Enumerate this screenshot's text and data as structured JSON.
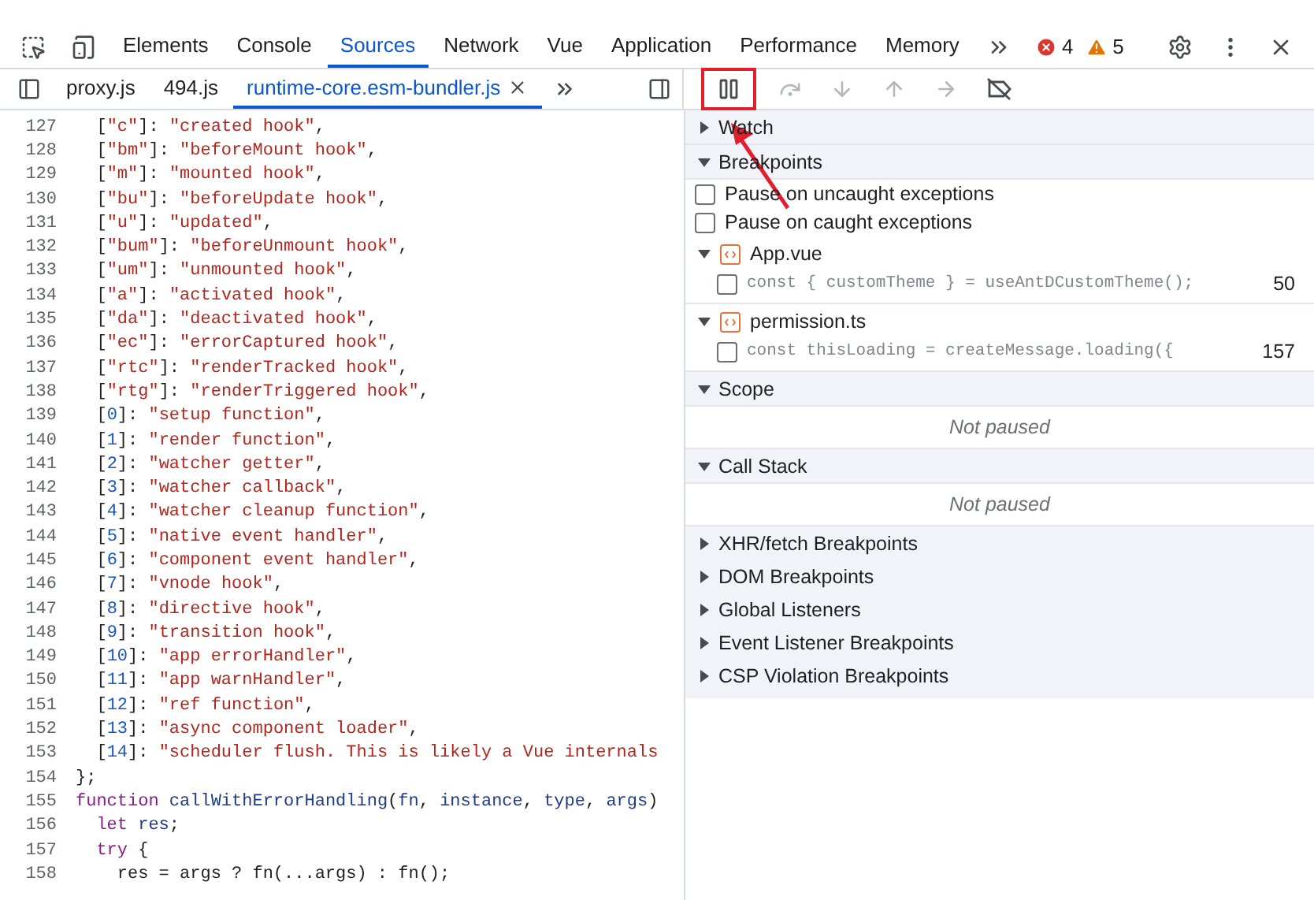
{
  "main_tabs": [
    {
      "label": "Elements",
      "selected": false
    },
    {
      "label": "Console",
      "selected": false
    },
    {
      "label": "Sources",
      "selected": true
    },
    {
      "label": "Network",
      "selected": false
    },
    {
      "label": "Vue",
      "selected": false
    },
    {
      "label": "Application",
      "selected": false
    },
    {
      "label": "Performance",
      "selected": false
    },
    {
      "label": "Memory",
      "selected": false
    }
  ],
  "issue_counts": {
    "errors": "4",
    "warnings": "5"
  },
  "file_tabs": [
    {
      "label": "proxy.js",
      "selected": false,
      "closable": false
    },
    {
      "label": "494.js",
      "selected": false,
      "closable": false
    },
    {
      "label": "runtime-core.esm-bundler.js",
      "selected": true,
      "closable": true
    }
  ],
  "debugger_controls": [
    {
      "kind": "pause",
      "disabled": false,
      "highlighted": true
    },
    {
      "kind": "step-over",
      "disabled": true,
      "highlighted": false
    },
    {
      "kind": "step-into",
      "disabled": true,
      "highlighted": false
    },
    {
      "kind": "step-out",
      "disabled": true,
      "highlighted": false
    },
    {
      "kind": "step",
      "disabled": true,
      "highlighted": false
    },
    {
      "kind": "deactivate-breakpoints",
      "disabled": false,
      "highlighted": false
    }
  ],
  "annotation_arrow": true,
  "code_lines": [
    {
      "n": "127",
      "tokens": [
        {
          "kind": "punctuation",
          "text": "  ["
        },
        {
          "kind": "string",
          "text": "\"c\""
        },
        {
          "kind": "punctuation",
          "text": "]: "
        },
        {
          "kind": "string",
          "text": "\"created hook\""
        },
        {
          "kind": "punctuation",
          "text": ","
        }
      ]
    },
    {
      "n": "128",
      "tokens": [
        {
          "kind": "punctuation",
          "text": "  ["
        },
        {
          "kind": "string",
          "text": "\"bm\""
        },
        {
          "kind": "punctuation",
          "text": "]: "
        },
        {
          "kind": "string",
          "text": "\"beforeMount hook\""
        },
        {
          "kind": "punctuation",
          "text": ","
        }
      ]
    },
    {
      "n": "129",
      "tokens": [
        {
          "kind": "punctuation",
          "text": "  ["
        },
        {
          "kind": "string",
          "text": "\"m\""
        },
        {
          "kind": "punctuation",
          "text": "]: "
        },
        {
          "kind": "string",
          "text": "\"mounted hook\""
        },
        {
          "kind": "punctuation",
          "text": ","
        }
      ]
    },
    {
      "n": "130",
      "tokens": [
        {
          "kind": "punctuation",
          "text": "  ["
        },
        {
          "kind": "string",
          "text": "\"bu\""
        },
        {
          "kind": "punctuation",
          "text": "]: "
        },
        {
          "kind": "string",
          "text": "\"beforeUpdate hook\""
        },
        {
          "kind": "punctuation",
          "text": ","
        }
      ]
    },
    {
      "n": "131",
      "tokens": [
        {
          "kind": "punctuation",
          "text": "  ["
        },
        {
          "kind": "string",
          "text": "\"u\""
        },
        {
          "kind": "punctuation",
          "text": "]: "
        },
        {
          "kind": "string",
          "text": "\"updated\""
        },
        {
          "kind": "punctuation",
          "text": ","
        }
      ]
    },
    {
      "n": "132",
      "tokens": [
        {
          "kind": "punctuation",
          "text": "  ["
        },
        {
          "kind": "string",
          "text": "\"bum\""
        },
        {
          "kind": "punctuation",
          "text": "]: "
        },
        {
          "kind": "string",
          "text": "\"beforeUnmount hook\""
        },
        {
          "kind": "punctuation",
          "text": ","
        }
      ]
    },
    {
      "n": "133",
      "tokens": [
        {
          "kind": "punctuation",
          "text": "  ["
        },
        {
          "kind": "string",
          "text": "\"um\""
        },
        {
          "kind": "punctuation",
          "text": "]: "
        },
        {
          "kind": "string",
          "text": "\"unmounted hook\""
        },
        {
          "kind": "punctuation",
          "text": ","
        }
      ]
    },
    {
      "n": "134",
      "tokens": [
        {
          "kind": "punctuation",
          "text": "  ["
        },
        {
          "kind": "string",
          "text": "\"a\""
        },
        {
          "kind": "punctuation",
          "text": "]: "
        },
        {
          "kind": "string",
          "text": "\"activated hook\""
        },
        {
          "kind": "punctuation",
          "text": ","
        }
      ]
    },
    {
      "n": "135",
      "tokens": [
        {
          "kind": "punctuation",
          "text": "  ["
        },
        {
          "kind": "string",
          "text": "\"da\""
        },
        {
          "kind": "punctuation",
          "text": "]: "
        },
        {
          "kind": "string",
          "text": "\"deactivated hook\""
        },
        {
          "kind": "punctuation",
          "text": ","
        }
      ]
    },
    {
      "n": "136",
      "tokens": [
        {
          "kind": "punctuation",
          "text": "  ["
        },
        {
          "kind": "string",
          "text": "\"ec\""
        },
        {
          "kind": "punctuation",
          "text": "]: "
        },
        {
          "kind": "string",
          "text": "\"errorCaptured hook\""
        },
        {
          "kind": "punctuation",
          "text": ","
        }
      ]
    },
    {
      "n": "137",
      "tokens": [
        {
          "kind": "punctuation",
          "text": "  ["
        },
        {
          "kind": "string",
          "text": "\"rtc\""
        },
        {
          "kind": "punctuation",
          "text": "]: "
        },
        {
          "kind": "string",
          "text": "\"renderTracked hook\""
        },
        {
          "kind": "punctuation",
          "text": ","
        }
      ]
    },
    {
      "n": "138",
      "tokens": [
        {
          "kind": "punctuation",
          "text": "  ["
        },
        {
          "kind": "string",
          "text": "\"rtg\""
        },
        {
          "kind": "punctuation",
          "text": "]: "
        },
        {
          "kind": "string",
          "text": "\"renderTriggered hook\""
        },
        {
          "kind": "punctuation",
          "text": ","
        }
      ]
    },
    {
      "n": "139",
      "tokens": [
        {
          "kind": "punctuation",
          "text": "  ["
        },
        {
          "kind": "number",
          "text": "0"
        },
        {
          "kind": "punctuation",
          "text": "]: "
        },
        {
          "kind": "string",
          "text": "\"setup function\""
        },
        {
          "kind": "punctuation",
          "text": ","
        }
      ]
    },
    {
      "n": "140",
      "tokens": [
        {
          "kind": "punctuation",
          "text": "  ["
        },
        {
          "kind": "number",
          "text": "1"
        },
        {
          "kind": "punctuation",
          "text": "]: "
        },
        {
          "kind": "string",
          "text": "\"render function\""
        },
        {
          "kind": "punctuation",
          "text": ","
        }
      ]
    },
    {
      "n": "141",
      "tokens": [
        {
          "kind": "punctuation",
          "text": "  ["
        },
        {
          "kind": "number",
          "text": "2"
        },
        {
          "kind": "punctuation",
          "text": "]: "
        },
        {
          "kind": "string",
          "text": "\"watcher getter\""
        },
        {
          "kind": "punctuation",
          "text": ","
        }
      ]
    },
    {
      "n": "142",
      "tokens": [
        {
          "kind": "punctuation",
          "text": "  ["
        },
        {
          "kind": "number",
          "text": "3"
        },
        {
          "kind": "punctuation",
          "text": "]: "
        },
        {
          "kind": "string",
          "text": "\"watcher callback\""
        },
        {
          "kind": "punctuation",
          "text": ","
        }
      ]
    },
    {
      "n": "143",
      "tokens": [
        {
          "kind": "punctuation",
          "text": "  ["
        },
        {
          "kind": "number",
          "text": "4"
        },
        {
          "kind": "punctuation",
          "text": "]: "
        },
        {
          "kind": "string",
          "text": "\"watcher cleanup function\""
        },
        {
          "kind": "punctuation",
          "text": ","
        }
      ]
    },
    {
      "n": "144",
      "tokens": [
        {
          "kind": "punctuation",
          "text": "  ["
        },
        {
          "kind": "number",
          "text": "5"
        },
        {
          "kind": "punctuation",
          "text": "]: "
        },
        {
          "kind": "string",
          "text": "\"native event handler\""
        },
        {
          "kind": "punctuation",
          "text": ","
        }
      ]
    },
    {
      "n": "145",
      "tokens": [
        {
          "kind": "punctuation",
          "text": "  ["
        },
        {
          "kind": "number",
          "text": "6"
        },
        {
          "kind": "punctuation",
          "text": "]: "
        },
        {
          "kind": "string",
          "text": "\"component event handler\""
        },
        {
          "kind": "punctuation",
          "text": ","
        }
      ]
    },
    {
      "n": "146",
      "tokens": [
        {
          "kind": "punctuation",
          "text": "  ["
        },
        {
          "kind": "number",
          "text": "7"
        },
        {
          "kind": "punctuation",
          "text": "]: "
        },
        {
          "kind": "string",
          "text": "\"vnode hook\""
        },
        {
          "kind": "punctuation",
          "text": ","
        }
      ]
    },
    {
      "n": "147",
      "tokens": [
        {
          "kind": "punctuation",
          "text": "  ["
        },
        {
          "kind": "number",
          "text": "8"
        },
        {
          "kind": "punctuation",
          "text": "]: "
        },
        {
          "kind": "string",
          "text": "\"directive hook\""
        },
        {
          "kind": "punctuation",
          "text": ","
        }
      ]
    },
    {
      "n": "148",
      "tokens": [
        {
          "kind": "punctuation",
          "text": "  ["
        },
        {
          "kind": "number",
          "text": "9"
        },
        {
          "kind": "punctuation",
          "text": "]: "
        },
        {
          "kind": "string",
          "text": "\"transition hook\""
        },
        {
          "kind": "punctuation",
          "text": ","
        }
      ]
    },
    {
      "n": "149",
      "tokens": [
        {
          "kind": "punctuation",
          "text": "  ["
        },
        {
          "kind": "number",
          "text": "10"
        },
        {
          "kind": "punctuation",
          "text": "]: "
        },
        {
          "kind": "string",
          "text": "\"app errorHandler\""
        },
        {
          "kind": "punctuation",
          "text": ","
        }
      ]
    },
    {
      "n": "150",
      "tokens": [
        {
          "kind": "punctuation",
          "text": "  ["
        },
        {
          "kind": "number",
          "text": "11"
        },
        {
          "kind": "punctuation",
          "text": "]: "
        },
        {
          "kind": "string",
          "text": "\"app warnHandler\""
        },
        {
          "kind": "punctuation",
          "text": ","
        }
      ]
    },
    {
      "n": "151",
      "tokens": [
        {
          "kind": "punctuation",
          "text": "  ["
        },
        {
          "kind": "number",
          "text": "12"
        },
        {
          "kind": "punctuation",
          "text": "]: "
        },
        {
          "kind": "string",
          "text": "\"ref function\""
        },
        {
          "kind": "punctuation",
          "text": ","
        }
      ]
    },
    {
      "n": "152",
      "tokens": [
        {
          "kind": "punctuation",
          "text": "  ["
        },
        {
          "kind": "number",
          "text": "13"
        },
        {
          "kind": "punctuation",
          "text": "]: "
        },
        {
          "kind": "string",
          "text": "\"async component loader\""
        },
        {
          "kind": "punctuation",
          "text": ","
        }
      ]
    },
    {
      "n": "153",
      "tokens": [
        {
          "kind": "punctuation",
          "text": "  ["
        },
        {
          "kind": "number",
          "text": "14"
        },
        {
          "kind": "punctuation",
          "text": "]: "
        },
        {
          "kind": "string",
          "text": "\"scheduler flush. This is likely a Vue internals"
        }
      ]
    },
    {
      "n": "154",
      "tokens": [
        {
          "kind": "punctuation",
          "text": "};"
        }
      ]
    },
    {
      "n": "155",
      "tokens": [
        {
          "kind": "keyword",
          "text": "function "
        },
        {
          "kind": "name",
          "text": "callWithErrorHandling"
        },
        {
          "kind": "punctuation",
          "text": "("
        },
        {
          "kind": "name",
          "text": "fn"
        },
        {
          "kind": "punctuation",
          "text": ", "
        },
        {
          "kind": "name",
          "text": "instance"
        },
        {
          "kind": "punctuation",
          "text": ", "
        },
        {
          "kind": "name",
          "text": "type"
        },
        {
          "kind": "punctuation",
          "text": ", "
        },
        {
          "kind": "name",
          "text": "args"
        },
        {
          "kind": "punctuation",
          "text": ")"
        }
      ]
    },
    {
      "n": "156",
      "tokens": [
        {
          "kind": "keyword",
          "text": "  let "
        },
        {
          "kind": "name",
          "text": "res"
        },
        {
          "kind": "punctuation",
          "text": ";"
        }
      ]
    },
    {
      "n": "157",
      "tokens": [
        {
          "kind": "keyword",
          "text": "  try "
        },
        {
          "kind": "punctuation",
          "text": "{"
        }
      ]
    },
    {
      "n": "158",
      "tokens": [
        {
          "kind": "punctuation",
          "text": "    res = args ? fn(...args) : fn();"
        }
      ]
    }
  ],
  "sidebar_sections": [
    {
      "kind": "header",
      "title": "Watch",
      "expanded": false
    },
    {
      "kind": "header",
      "title": "Breakpoints",
      "expanded": true
    },
    {
      "kind": "checkbox",
      "label": "Pause on uncaught exceptions",
      "checked": false
    },
    {
      "kind": "checkbox",
      "label": "Pause on caught exceptions",
      "checked": false
    },
    {
      "kind": "file",
      "title": "App.vue",
      "expanded": true,
      "breakpoints": [
        {
          "code": "const { customTheme } = useAntDCustomTheme();",
          "line": "50",
          "checked": false
        }
      ]
    },
    {
      "kind": "file",
      "title": "permission.ts",
      "expanded": true,
      "breakpoints": [
        {
          "code": "const thisLoading = createMessage.loading({",
          "line": "157",
          "checked": false
        }
      ]
    },
    {
      "kind": "header",
      "title": "Scope",
      "expanded": true
    },
    {
      "kind": "empty",
      "text": "Not paused"
    },
    {
      "kind": "header",
      "title": "Call Stack",
      "expanded": true
    },
    {
      "kind": "empty",
      "text": "Not paused"
    },
    {
      "kind": "header",
      "title": "XHR/fetch Breakpoints",
      "expanded": false
    },
    {
      "kind": "header",
      "title": "DOM Breakpoints",
      "expanded": false
    },
    {
      "kind": "header",
      "title": "Global Listeners",
      "expanded": false
    },
    {
      "kind": "header",
      "title": "Event Listener Breakpoints",
      "expanded": false
    },
    {
      "kind": "header",
      "title": "CSP Violation Breakpoints",
      "expanded": false
    }
  ]
}
